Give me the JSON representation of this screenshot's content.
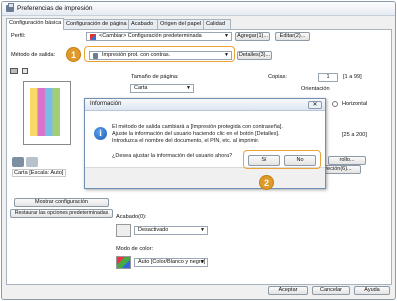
{
  "window": {
    "title": "Preferencias de impresión"
  },
  "tabs": [
    {
      "label": "Configuración básica"
    },
    {
      "label": "Configuración de página"
    },
    {
      "label": "Acabado"
    },
    {
      "label": "Origen del papel"
    },
    {
      "label": "Calidad"
    }
  ],
  "profile": {
    "label": "Perfil:",
    "value": "<Cambiar> Configuración predeterminada",
    "add_button": "Agregar(1)...",
    "edit_button": "Editar(2)..."
  },
  "output": {
    "label": "Método de salida:",
    "value": "Impresión prot. con contras.",
    "details_button": "Detalles(3)..."
  },
  "page_size": {
    "label": "Tamaño de página:",
    "value": "Carta"
  },
  "copies": {
    "label": "Copias:",
    "value": "1",
    "range": "[1 a 99]"
  },
  "orientation": {
    "label": "Orientación",
    "option": "Horizontal"
  },
  "hidden_fragments": {
    "zoom_range": "[25 a 200]",
    "trunc_button": "rollo...",
    "trunc_button2": "reción(6)..."
  },
  "preview_caption": "Carta [Escala: Auto]",
  "left_buttons": {
    "show_config": "Mostrar configuración",
    "restore": "Restaurar las opciones predeterminadas"
  },
  "finishing": {
    "label": "Acabado(0):",
    "value": "Desactivado"
  },
  "color_mode": {
    "label": "Modo de color:",
    "value": "Auto [Color/Blanco y negro]"
  },
  "footer": {
    "ok": "Aceptar",
    "cancel": "Cancelar",
    "help": "Ayuda"
  },
  "dialog": {
    "title": "Información",
    "lines": [
      "El método de salida cambiará a [Impresión protegida con contraseña].",
      "Ajuste la información del usuario haciendo clic en el botón [Detalles].",
      "Introduzca el nombre del documento, el PIN, etc. al imprimir."
    ],
    "question": "¿Desea ajustar la información del usuario ahora?",
    "yes": "Sí",
    "no": "No"
  },
  "callouts": {
    "one": "1",
    "two": "2"
  },
  "colors": {
    "callout": "#e09a2a",
    "dialog_border": "#6f8fb4"
  }
}
